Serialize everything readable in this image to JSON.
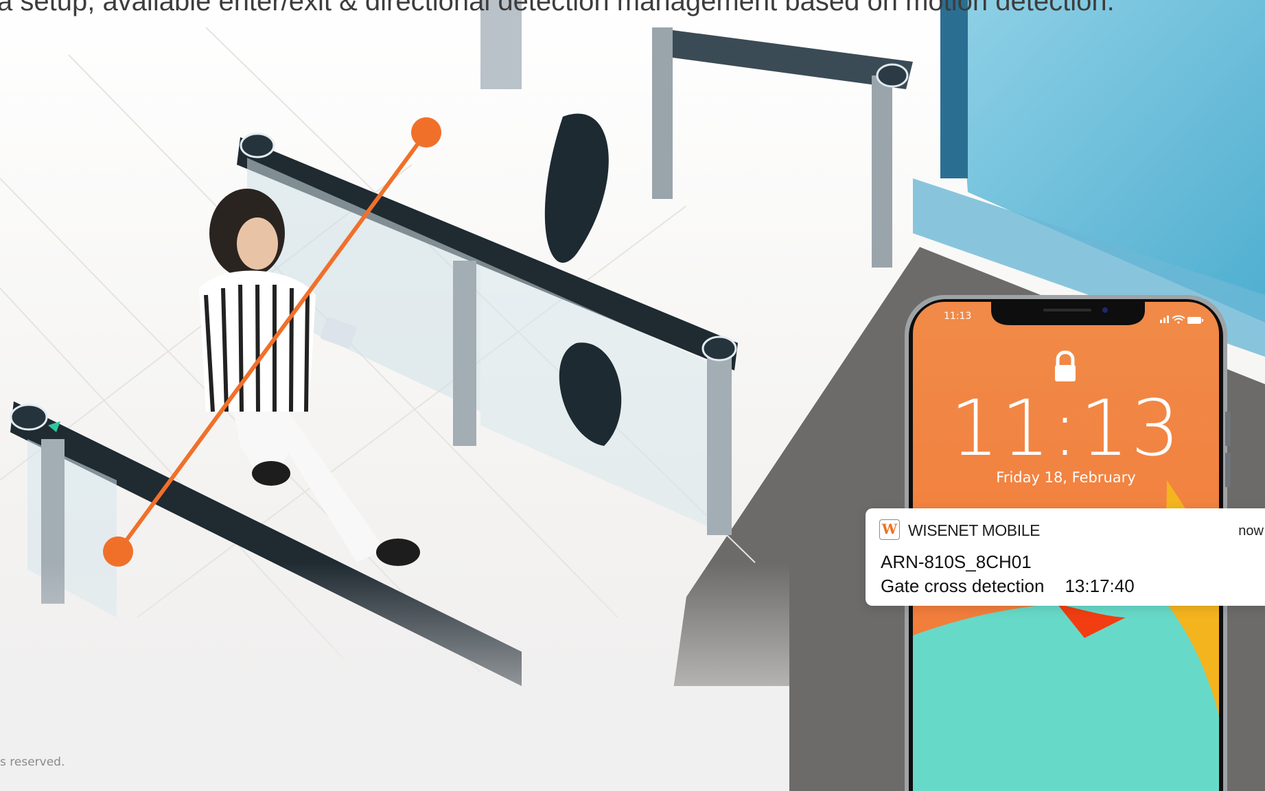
{
  "headline": "a setup, available enter/exit & directional detection management based on motion detection.",
  "footer": "s reserved.",
  "colors": {
    "accent_orange": "#f0702a",
    "phone_orange": "#f28a48",
    "phone_teal": "#67d9c8",
    "phone_yellow": "#f4b41e"
  },
  "icons": {
    "lock": "lock-icon",
    "signal": "signal-icon",
    "wifi": "wifi-icon",
    "battery": "battery-icon",
    "app_logo": "wisenet-logo"
  },
  "phone": {
    "status_time": "11:13",
    "clock": "11:13",
    "date": "Friday 18, February"
  },
  "notification": {
    "app_logo_text": "W",
    "app_name": "WISENET MOBILE",
    "time": "now",
    "device": "ARN-810S_8CH01",
    "event": "Gate cross detection",
    "timestamp": "13:17:40"
  }
}
